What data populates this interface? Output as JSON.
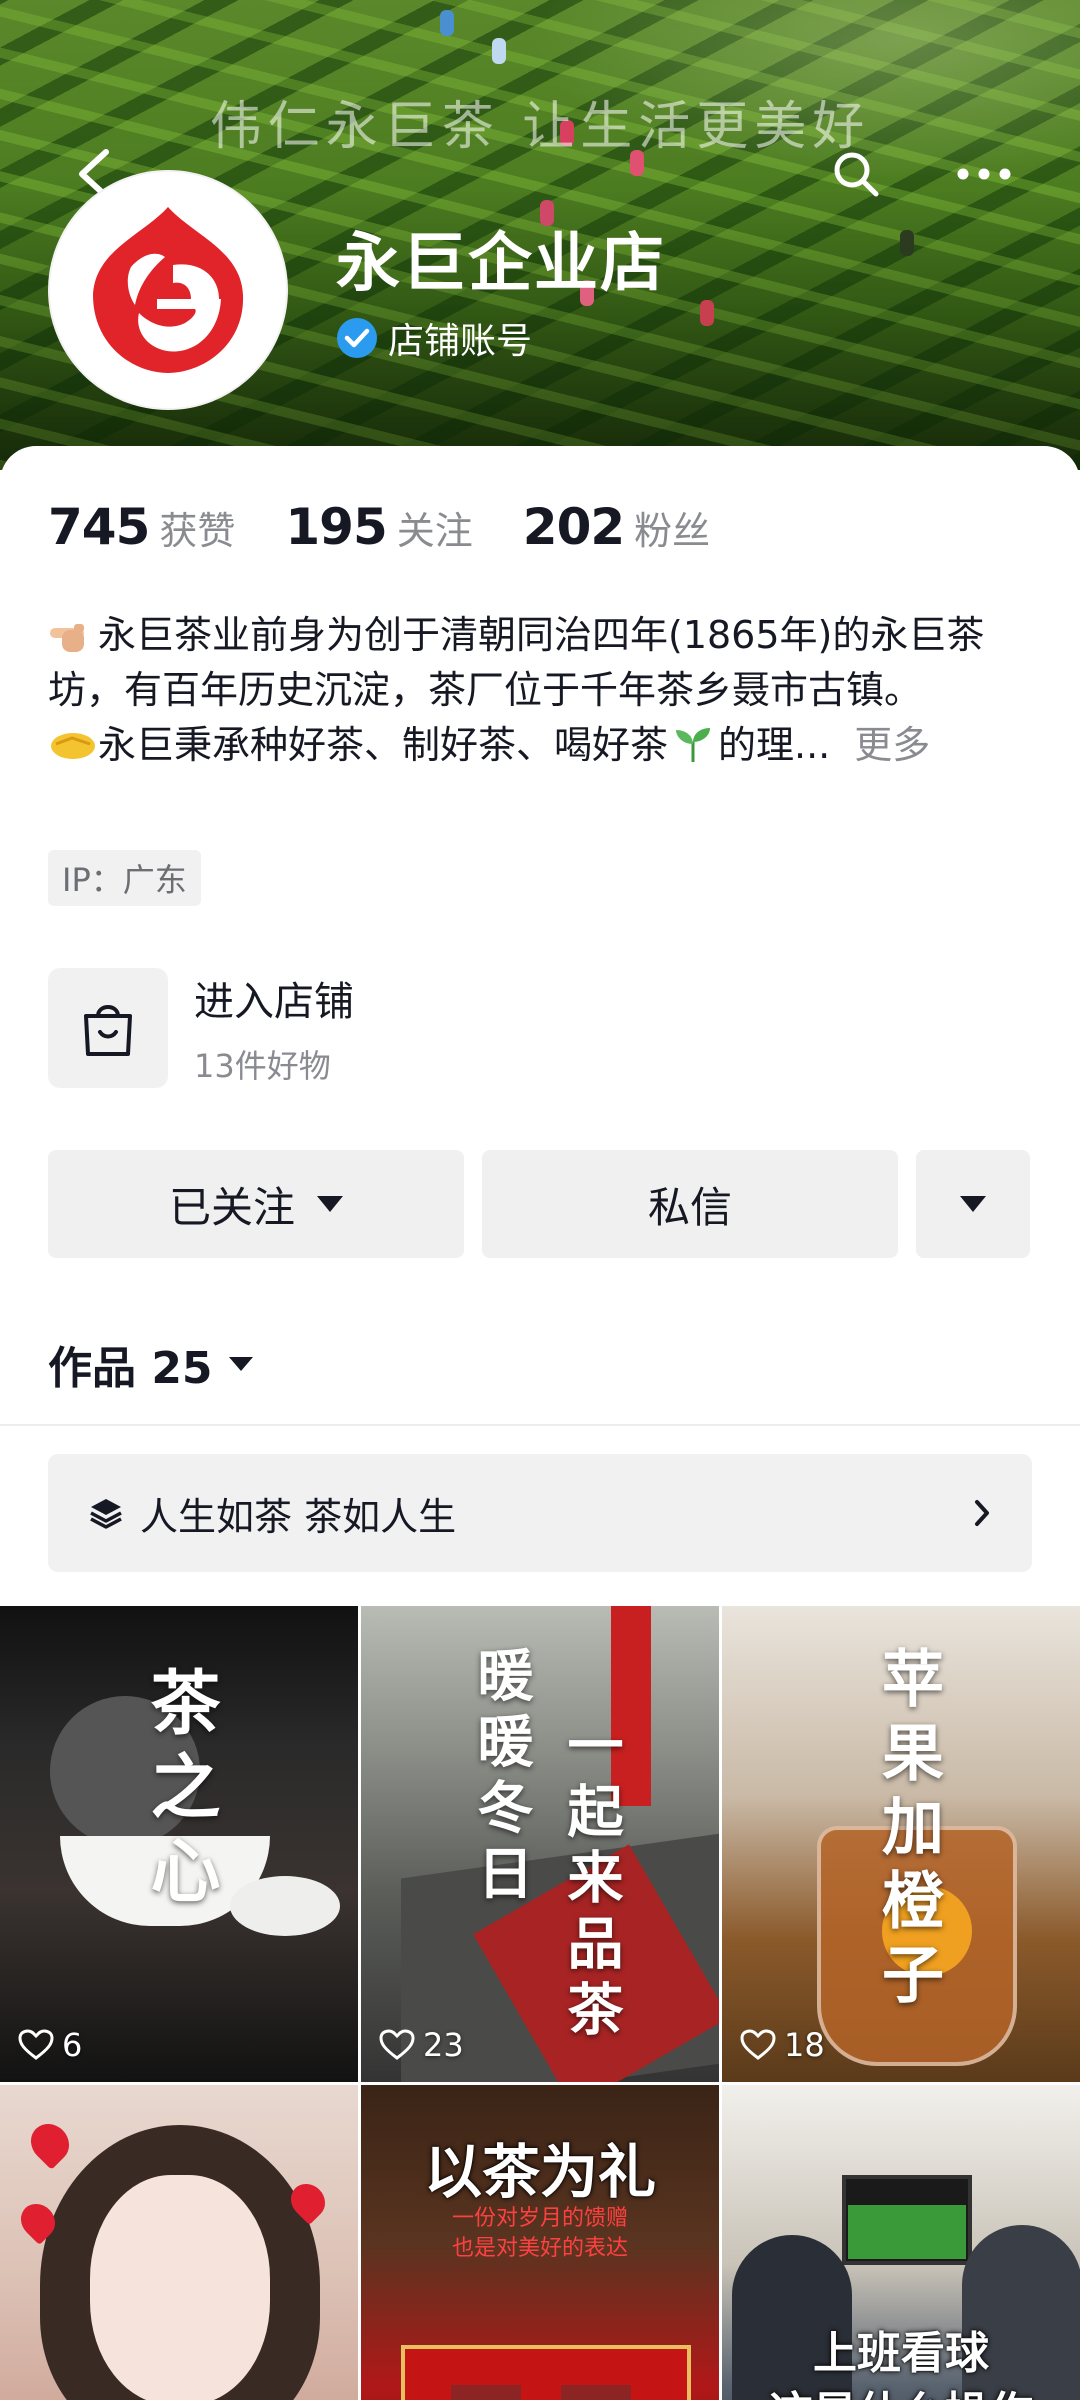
{
  "banner": {
    "slogan": "伟仁永巨茶  让生活更美好"
  },
  "header": {
    "shop_name": "永巨企业店",
    "account_type": "店铺账号"
  },
  "stats": [
    {
      "value": "745",
      "label": "获赞"
    },
    {
      "value": "195",
      "label": "关注"
    },
    {
      "value": "202",
      "label": "粉丝"
    }
  ],
  "bio": {
    "line1": "永巨茶业前身为创于清朝同治四年(1865年)的永巨茶坊，有百年历史沉淀，茶厂位于千年茶乡聂市古镇。",
    "line2a": "永巨秉承种好茶、制好茶、喝好茶",
    "line2b": "的理...",
    "more": "更多"
  },
  "ip_tag": "IP：广东",
  "shop_entry": {
    "title": "进入店铺",
    "subtitle": "13件好物"
  },
  "buttons": {
    "follow": "已关注",
    "message": "私信"
  },
  "works": {
    "title": "作品 25"
  },
  "collection": {
    "label": "人生如茶 茶如人生"
  },
  "videos": [
    {
      "likes": "6",
      "overlay": "茶之心"
    },
    {
      "likes": "23",
      "overlay_a": "暖暖冬日",
      "overlay_b": "一起来品茶"
    },
    {
      "likes": "18",
      "overlay": "苹果加橙子"
    },
    {
      "likes": ""
    },
    {
      "title": "以茶为礼",
      "sub1": "一份对岁月的馈赠",
      "sub2": "也是对美好的表达"
    },
    {
      "title1": "上班看球",
      "title2": "这是什么操作"
    }
  ],
  "colors": {
    "accent_blue": "#2b9bf0",
    "brand_red": "#e0242a",
    "text_primary": "#161823",
    "text_secondary": "#8a8b91"
  }
}
